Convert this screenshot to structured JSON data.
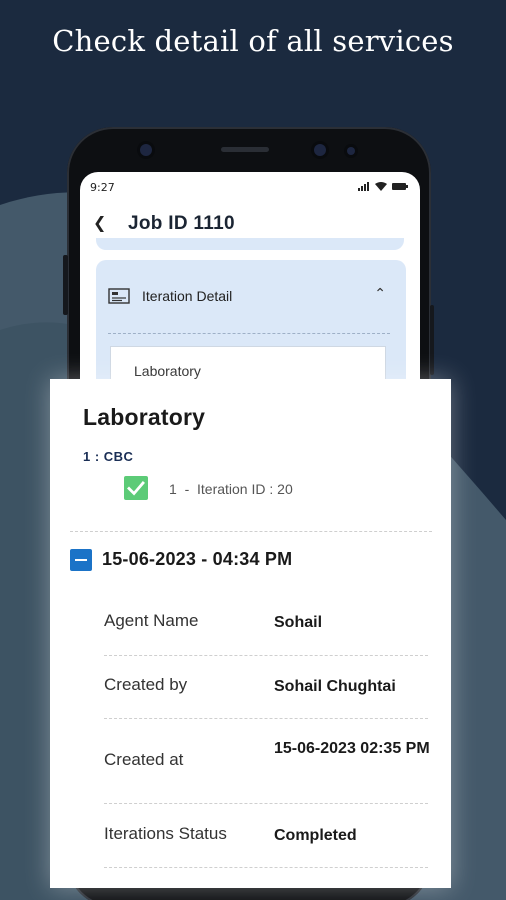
{
  "headline": "Check detail of all services",
  "phone": {
    "status_bar": {
      "time": "9:27"
    },
    "app_bar": {
      "title": "Job ID 1110",
      "back_icon": "back-arrow-icon"
    },
    "iteration_section": {
      "label": "Iteration Detail",
      "icon": "document-icon",
      "toggle_icon": "chevron-up-icon",
      "service_preview": "Laboratory"
    }
  },
  "overlay": {
    "service_title": "Laboratory",
    "service_item": "1 : CBC",
    "iteration": {
      "checked": true,
      "text": "1  -  Iteration ID : 20"
    },
    "entry": {
      "datetime": "15-06-2023 - 04:34 PM",
      "expanded": true,
      "details": [
        {
          "label": "Agent Name",
          "value": "Sohail"
        },
        {
          "label": "Created by",
          "value": "Sohail Chughtai"
        },
        {
          "label": "Created at",
          "value": "15-06-2023 02:35 PM"
        },
        {
          "label": "Iterations Status",
          "value": "Completed"
        }
      ]
    }
  },
  "colors": {
    "background_dark": "#1b2a3f",
    "background_wave": "#3f5766",
    "card_blue": "#dbe8f8",
    "accent_blue": "#1b73c7",
    "check_green": "#5ccb77"
  }
}
